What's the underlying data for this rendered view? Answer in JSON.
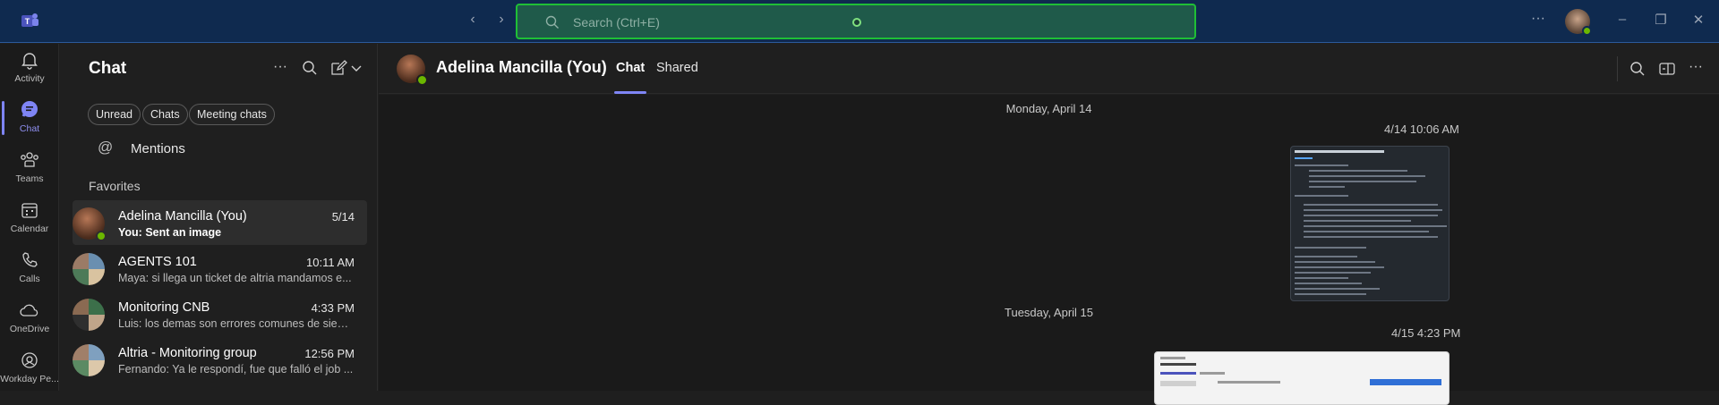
{
  "titlebar": {
    "search_placeholder": "Search (Ctrl+E)",
    "back_icon": "chevron-left-icon",
    "forward_icon": "chevron-right-icon",
    "more_label": "···"
  },
  "rail": {
    "items": [
      {
        "label": "Activity",
        "icon": "bell-icon"
      },
      {
        "label": "Chat",
        "icon": "chat-icon",
        "active": true
      },
      {
        "label": "Teams",
        "icon": "teams-icon"
      },
      {
        "label": "Calendar",
        "icon": "calendar-icon"
      },
      {
        "label": "Calls",
        "icon": "phone-icon"
      },
      {
        "label": "OneDrive",
        "icon": "cloud-icon"
      },
      {
        "label": "Workday Pe...",
        "icon": "workday-icon"
      }
    ]
  },
  "chatlist": {
    "title": "Chat",
    "filters": [
      "Unread",
      "Chats",
      "Meeting chats"
    ],
    "mentions_label": "Mentions",
    "favorites_label": "Favorites",
    "chats": [
      {
        "name": "Adelina Mancilla (You)",
        "time": "5/14",
        "preview": "You: Sent an image",
        "active": true
      },
      {
        "name": "AGENTS 101",
        "time": "10:11 AM",
        "preview": "Maya: si llega un ticket de altria  mandamos e..."
      },
      {
        "name": "Monitoring CNB",
        "time": "4:33 PM",
        "preview": "Luis: los demas son errores comunes de siem..."
      },
      {
        "name": "Altria - Monitoring group",
        "time": "12:56 PM",
        "preview": "Fernando: Ya le respondí, fue que falló el job ..."
      }
    ]
  },
  "conversation": {
    "name": "Adelina Mancilla (You)",
    "tabs": [
      "Chat",
      "Shared"
    ],
    "active_tab": "Chat",
    "messages": [
      {
        "day": "Monday, April 14",
        "stamp": "4/14 10:06 AM"
      },
      {
        "day": "Tuesday, April 15",
        "stamp": "4/15 4:23 PM"
      }
    ]
  },
  "colors": {
    "accent": "#7f85f5",
    "titlebar": "#0f2a4f",
    "search_highlight": "#1fbf36",
    "presence_available": "#6bb700"
  }
}
